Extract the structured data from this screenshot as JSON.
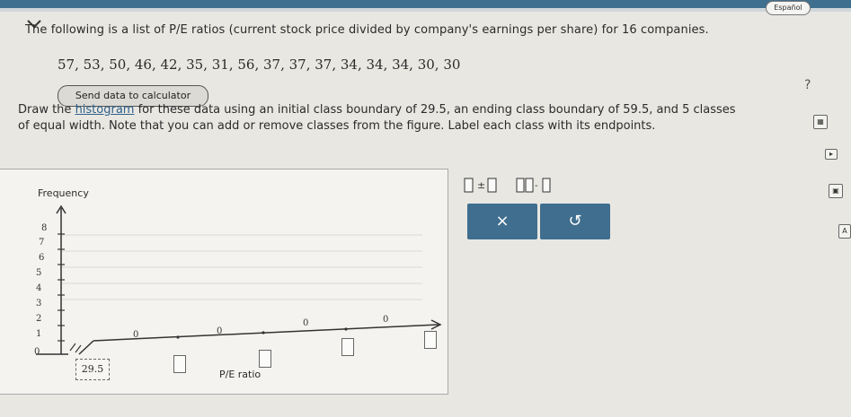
{
  "header": {
    "lang_label": "Español"
  },
  "question": {
    "text": "The following is a list of P/E ratios (current stock price divided by company's earnings per share) for 16 companies.",
    "data_values": "57, 53, 50, 46, 42, 35, 31, 56, 37, 37, 37, 34, 34, 34, 30, 30",
    "send_button_label": "Send data to calculator"
  },
  "instructions": {
    "line1_prefix": "Draw the ",
    "link": "histogram",
    "line1_suffix": " for these data using an initial class boundary of 29.5, an ending class boundary of 59.5, and 5 classes",
    "line2": "of equal width. Note that you can add or remove classes from the figure. Label each class with its endpoints."
  },
  "help": {
    "icon_label": "?"
  },
  "graph": {
    "y_label": "Frequency",
    "x_label": "P/E ratio",
    "y_ticks": [
      "0",
      "1",
      "2",
      "3",
      "4",
      "5",
      "6",
      "7",
      "8"
    ],
    "start_boundary": "29.5",
    "class_counts": [
      "0",
      "0",
      "0",
      "0"
    ]
  },
  "tools": {
    "add_class_icon": "add-class-icon",
    "remove_class_icon": "remove-class-icon",
    "clear_label": "×",
    "undo_label": "↺"
  },
  "colors": {
    "accent": "#3f6e8e",
    "topbar": "#3f6f8f"
  }
}
